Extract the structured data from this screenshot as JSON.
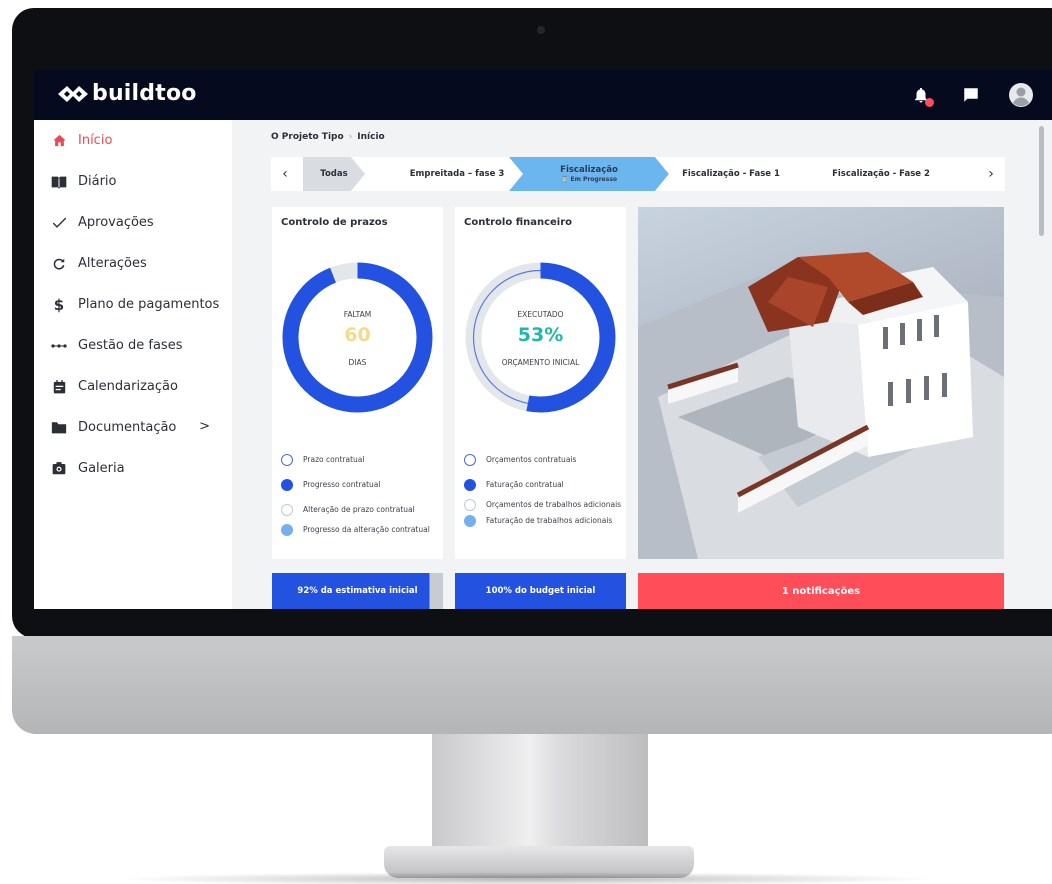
{
  "app": {
    "brand": "buildtoo"
  },
  "sidebar": {
    "items": [
      {
        "label": "Início",
        "icon": "home-icon",
        "active": true
      },
      {
        "label": "Diário",
        "icon": "book-icon"
      },
      {
        "label": "Aprovações",
        "icon": "check-icon"
      },
      {
        "label": "Alterações",
        "icon": "refresh-icon"
      },
      {
        "label": "Plano de pagamentos",
        "icon": "dollar-icon"
      },
      {
        "label": "Gestão de fases",
        "icon": "timeline-icon"
      },
      {
        "label": "Calendarização",
        "icon": "calendar-icon"
      },
      {
        "label": "Documentação",
        "icon": "folder-icon"
      },
      {
        "label": "Galeria",
        "icon": "camera-icon"
      }
    ]
  },
  "breadcrumb": {
    "project": "O Projeto Tipo",
    "page": "Início",
    "separator": "›"
  },
  "phases": {
    "prev": "‹",
    "next": "›",
    "items": [
      {
        "label": "Todas"
      },
      {
        "label": "Empreitada – fase 3"
      },
      {
        "label": "Fiscalização",
        "status": "⌛ Em Progresso",
        "active": true
      },
      {
        "label": "Fiscalização - Fase 1"
      },
      {
        "label": "Fiscalização - Fase 2"
      }
    ]
  },
  "prazos": {
    "title": "Controlo de prazos",
    "top_label": "FALTAM",
    "value": "60",
    "bottom_label": "DIAS",
    "progress": 0.94,
    "legend": [
      "Prazo contratual",
      "Progresso contratual",
      "Alteração de prazo contratual",
      "Progresso da alteração contratual"
    ],
    "banner": "92% da estimativa inicial"
  },
  "financeiro": {
    "title": "Controlo financeiro",
    "top_label": "EXECUTADO",
    "value": "53%",
    "bottom_label": "ORÇAMENTO INICIAL",
    "progress": 0.53,
    "legend": [
      "Orçamentos contratuais",
      "Faturação contratual",
      "Orçamentos de trabalhos adicionais",
      "Faturação de trabalhos adicionais"
    ],
    "banner": "100% do budget inicial"
  },
  "notifications": {
    "banner": "1 notificações"
  },
  "colors": {
    "accent": "#2352e0",
    "danger": "#ff4d5a",
    "active_nav": "#e84b54",
    "days": "#f6d98a",
    "percent": "#1fb8a8",
    "phase_active": "#6cb6f0"
  }
}
